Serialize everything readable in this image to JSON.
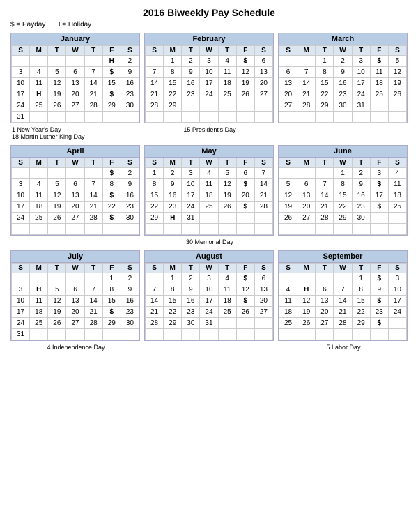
{
  "title": "2016 Biweekly Pay Schedule",
  "legend": {
    "payday": "$ = Payday",
    "holiday": "H = Holiday"
  },
  "rows": [
    {
      "months": [
        {
          "name": "January",
          "days": [
            "S",
            "M",
            "T",
            "W",
            "T",
            "F",
            "S"
          ],
          "weeks": [
            [
              "",
              "",
              "",
              "",
              "",
              "H",
              "2"
            ],
            [
              "3",
              "4",
              "5",
              "6",
              "7",
              "$",
              "9"
            ],
            [
              "10",
              "11",
              "12",
              "13",
              "14",
              "15",
              "16"
            ],
            [
              "17",
              "H",
              "19",
              "20",
              "21",
              "$",
              "23"
            ],
            [
              "24",
              "25",
              "26",
              "27",
              "28",
              "29",
              "30"
            ],
            [
              "31",
              "",
              "",
              "",
              "",
              "",
              ""
            ]
          ]
        },
        {
          "name": "February",
          "days": [
            "S",
            "M",
            "T",
            "W",
            "T",
            "F",
            "S"
          ],
          "weeks": [
            [
              "",
              "1",
              "2",
              "3",
              "4",
              "$",
              "6"
            ],
            [
              "7",
              "8",
              "9",
              "10",
              "11",
              "12",
              "13"
            ],
            [
              "14",
              "15",
              "16",
              "17",
              "18",
              "19",
              "20"
            ],
            [
              "21",
              "22",
              "23",
              "24",
              "25",
              "26",
              "27"
            ],
            [
              "28",
              "29",
              "",
              "",
              "",
              "",
              ""
            ],
            [
              "",
              "",
              "",
              "",
              "",
              "",
              ""
            ]
          ]
        },
        {
          "name": "March",
          "days": [
            "S",
            "M",
            "T",
            "W",
            "T",
            "F",
            "S"
          ],
          "weeks": [
            [
              "",
              "",
              "1",
              "2",
              "3",
              "$",
              "5"
            ],
            [
              "6",
              "7",
              "8",
              "9",
              "10",
              "11",
              "12"
            ],
            [
              "13",
              "14",
              "15",
              "16",
              "17",
              "18",
              "19"
            ],
            [
              "20",
              "21",
              "22",
              "23",
              "24",
              "25",
              "26"
            ],
            [
              "27",
              "28",
              "29",
              "30",
              "31",
              "",
              ""
            ],
            [
              "",
              "",
              "",
              "",
              "",
              "",
              ""
            ]
          ]
        }
      ],
      "notes": [
        "1 New Year's Day\n18 Martin Luther King Day",
        "15 President's Day",
        ""
      ]
    },
    {
      "months": [
        {
          "name": "April",
          "days": [
            "S",
            "M",
            "T",
            "W",
            "T",
            "F",
            "S"
          ],
          "weeks": [
            [
              "",
              "",
              "",
              "",
              "",
              "$",
              "2"
            ],
            [
              "3",
              "4",
              "5",
              "6",
              "7",
              "8",
              "9"
            ],
            [
              "10",
              "11",
              "12",
              "13",
              "14",
              "$",
              "16"
            ],
            [
              "17",
              "18",
              "19",
              "20",
              "21",
              "22",
              "23"
            ],
            [
              "24",
              "25",
              "26",
              "27",
              "28",
              "$",
              "30"
            ],
            [
              "",
              "",
              "",
              "",
              "",
              "",
              ""
            ]
          ]
        },
        {
          "name": "May",
          "days": [
            "S",
            "M",
            "T",
            "W",
            "T",
            "F",
            "S"
          ],
          "weeks": [
            [
              "1",
              "2",
              "3",
              "4",
              "5",
              "6",
              "7"
            ],
            [
              "8",
              "9",
              "10",
              "11",
              "12",
              "$",
              "14"
            ],
            [
              "15",
              "16",
              "17",
              "18",
              "19",
              "20",
              "21"
            ],
            [
              "22",
              "23",
              "24",
              "25",
              "26",
              "$",
              "28"
            ],
            [
              "29",
              "H",
              "31",
              "",
              "",
              "",
              ""
            ],
            [
              "",
              "",
              "",
              "",
              "",
              "",
              ""
            ]
          ]
        },
        {
          "name": "June",
          "days": [
            "S",
            "M",
            "T",
            "W",
            "T",
            "F",
            "S"
          ],
          "weeks": [
            [
              "",
              "",
              "",
              "1",
              "2",
              "3",
              "4"
            ],
            [
              "5",
              "6",
              "7",
              "8",
              "9",
              "$",
              "11"
            ],
            [
              "12",
              "13",
              "14",
              "15",
              "16",
              "17",
              "18"
            ],
            [
              "19",
              "20",
              "21",
              "22",
              "23",
              "$",
              "25"
            ],
            [
              "26",
              "27",
              "28",
              "29",
              "30",
              "",
              ""
            ],
            [
              "",
              "",
              "",
              "",
              "",
              "",
              ""
            ]
          ]
        }
      ],
      "notes": [
        "",
        "30 Memorial Day",
        ""
      ]
    },
    {
      "months": [
        {
          "name": "July",
          "days": [
            "S",
            "M",
            "T",
            "W",
            "T",
            "F",
            "S"
          ],
          "weeks": [
            [
              "",
              "",
              "",
              "",
              "",
              "1",
              "2"
            ],
            [
              "3",
              "H",
              "5",
              "6",
              "7",
              "8",
              "9"
            ],
            [
              "10",
              "11",
              "12",
              "13",
              "14",
              "15",
              "16"
            ],
            [
              "17",
              "18",
              "19",
              "20",
              "21",
              "$",
              "23"
            ],
            [
              "24",
              "25",
              "26",
              "27",
              "28",
              "29",
              "30"
            ],
            [
              "31",
              "",
              "",
              "",
              "",
              "",
              ""
            ]
          ]
        },
        {
          "name": "August",
          "days": [
            "S",
            "M",
            "T",
            "W",
            "T",
            "F",
            "S"
          ],
          "weeks": [
            [
              "",
              "1",
              "2",
              "3",
              "4",
              "$",
              "6"
            ],
            [
              "7",
              "8",
              "9",
              "10",
              "11",
              "12",
              "13"
            ],
            [
              "14",
              "15",
              "16",
              "17",
              "18",
              "$",
              "20"
            ],
            [
              "21",
              "22",
              "23",
              "24",
              "25",
              "26",
              "27"
            ],
            [
              "28",
              "29",
              "30",
              "31",
              "",
              "",
              ""
            ],
            [
              "",
              "",
              "",
              "",
              "",
              "",
              ""
            ]
          ]
        },
        {
          "name": "September",
          "days": [
            "S",
            "M",
            "T",
            "W",
            "T",
            "F",
            "S"
          ],
          "weeks": [
            [
              "",
              "",
              "",
              "",
              "1",
              "$",
              "3"
            ],
            [
              "4",
              "H",
              "6",
              "7",
              "8",
              "9",
              "10"
            ],
            [
              "11",
              "12",
              "13",
              "14",
              "15",
              "$",
              "17"
            ],
            [
              "18",
              "19",
              "20",
              "21",
              "22",
              "23",
              "24"
            ],
            [
              "25",
              "26",
              "27",
              "28",
              "29",
              "$",
              ""
            ],
            [
              "",
              "",
              "",
              "",
              "",
              "",
              ""
            ]
          ]
        }
      ],
      "notes": [
        "4 Independence Day",
        "",
        "5 Labor Day"
      ]
    }
  ]
}
